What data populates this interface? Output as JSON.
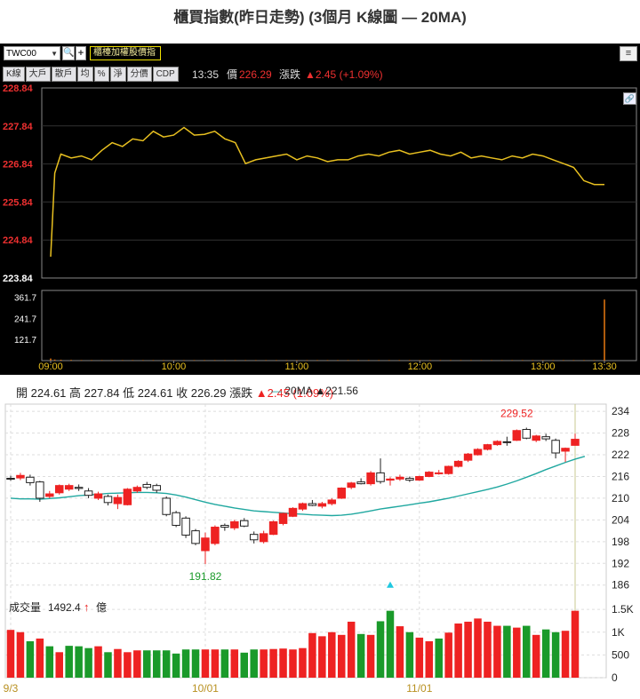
{
  "page_title": "櫃買指數(昨日走勢) (3個月 K線圖  — 20MA)",
  "intraday": {
    "symbol": "TWC00",
    "symbol_dropdown": "▼",
    "search_glyph": "🔍",
    "add_glyph": "+",
    "index_name": "櫃檯加權股價指",
    "menu_glyph": "≡",
    "link_glyph": "🔗",
    "buttons": [
      "K線",
      "大戶",
      "散戶",
      "均",
      "%",
      "淨",
      "分價",
      "CDP"
    ],
    "time": "13:35",
    "price_label": "價",
    "price": "226.29",
    "change_label": "漲跌",
    "change": "▲2.45 (+1.09%)",
    "price_ticks": [
      "228.84",
      "227.84",
      "226.84",
      "225.84",
      "224.84",
      "223.84"
    ],
    "volume_ticks": [
      "361.7",
      "241.7",
      "121.7"
    ],
    "time_ticks": [
      "09:00",
      "10:00",
      "11:00",
      "12:00",
      "13:00",
      "13:30"
    ],
    "colors": {
      "price_line": "#e8c020",
      "volume": "#d87010",
      "up": "#ee2222",
      "down": "#1a9a2a",
      "ma": "#20a8a0"
    }
  },
  "chart_data": [
    {
      "type": "line",
      "name_hint": "intraday",
      "x": [
        "09:00",
        "09:02",
        "09:05",
        "09:10",
        "09:15",
        "09:20",
        "09:25",
        "09:30",
        "09:35",
        "09:40",
        "09:45",
        "09:50",
        "09:55",
        "10:00",
        "10:05",
        "10:10",
        "10:15",
        "10:20",
        "10:25",
        "10:30",
        "10:35",
        "10:40",
        "10:45",
        "10:50",
        "10:55",
        "11:00",
        "11:05",
        "11:10",
        "11:15",
        "11:20",
        "11:25",
        "11:30",
        "11:35",
        "11:40",
        "11:45",
        "11:50",
        "11:55",
        "12:00",
        "12:05",
        "12:10",
        "12:15",
        "12:20",
        "12:25",
        "12:30",
        "12:35",
        "12:40",
        "12:45",
        "12:50",
        "12:55",
        "13:00",
        "13:05",
        "13:10",
        "13:15",
        "13:20",
        "13:25",
        "13:30"
      ],
      "values": [
        224.4,
        226.6,
        227.1,
        227.0,
        227.05,
        226.95,
        227.2,
        227.4,
        227.3,
        227.5,
        227.45,
        227.7,
        227.55,
        227.6,
        227.8,
        227.6,
        227.62,
        227.7,
        227.5,
        227.4,
        226.85,
        226.95,
        227.0,
        227.05,
        227.1,
        226.95,
        227.05,
        227.0,
        226.9,
        226.95,
        226.95,
        227.05,
        227.1,
        227.05,
        227.15,
        227.2,
        227.1,
        227.15,
        227.2,
        227.1,
        227.05,
        227.15,
        227.0,
        227.05,
        227.0,
        226.95,
        227.05,
        227.0,
        227.1,
        227.05,
        226.95,
        226.85,
        226.75,
        226.4,
        226.3,
        226.3
      ],
      "ylim": [
        223.84,
        228.84
      ],
      "volume": [
        12,
        6,
        5,
        4,
        3,
        3,
        3,
        3,
        3,
        3,
        3,
        3,
        3,
        3,
        3,
        3,
        3,
        3,
        3,
        3,
        3,
        3,
        3,
        3,
        3,
        3,
        3,
        3,
        3,
        3,
        3,
        3,
        3,
        3,
        3,
        3,
        3,
        3,
        3,
        3,
        3,
        3,
        3,
        3,
        3,
        3,
        3,
        3,
        3,
        3,
        3,
        3,
        3,
        3,
        3,
        348
      ],
      "volume_ylim": [
        0,
        400
      ]
    },
    {
      "type": "candlestick",
      "name_hint": "daily 3 months",
      "ohlc_header": {
        "open_label": "開",
        "open": "224.61",
        "high_label": "高",
        "high": "227.84",
        "low_label": "低",
        "low": "224.61",
        "close_label": "收",
        "close": "226.29",
        "change_label": "漲跌",
        "change": "▲2.45 (1.09%)"
      },
      "ma": {
        "label": "20MA",
        "value": "▲221.56"
      },
      "price_ticks": [
        "234",
        "228",
        "222",
        "216",
        "210",
        "204",
        "198",
        "192",
        "186"
      ],
      "volume_ticks": [
        "1.5K",
        "1K",
        "500",
        "0"
      ],
      "date_ticks": [
        "9/3",
        "10/01",
        "11/01"
      ],
      "annotations": {
        "high": "229.52",
        "low": "191.82"
      },
      "volume_header": {
        "label": "成交量",
        "value": "1492.4",
        "arrow": "↑",
        "unit": "億"
      },
      "ylim": [
        182,
        236
      ],
      "volume_ylim": [
        0,
        1600
      ],
      "candles": [
        [
          215.5,
          216.2,
          214.8,
          215.4
        ],
        [
          215.6,
          217.0,
          215.0,
          216.3
        ],
        [
          215.8,
          216.5,
          213.5,
          214.3
        ],
        [
          214.5,
          214.8,
          209.0,
          210.0
        ],
        [
          210.5,
          212.0,
          210.0,
          211.2
        ],
        [
          211.5,
          213.8,
          211.0,
          213.5
        ],
        [
          212.5,
          214.0,
          212.0,
          213.5
        ],
        [
          213.0,
          213.8,
          212.0,
          212.7
        ],
        [
          212.0,
          212.8,
          210.0,
          210.8
        ],
        [
          210.0,
          211.8,
          209.5,
          211.2
        ],
        [
          210.5,
          211.0,
          208.0,
          208.8
        ],
        [
          208.5,
          211.0,
          207.0,
          210.2
        ],
        [
          208.2,
          212.8,
          208.0,
          212.5
        ],
        [
          212.0,
          213.5,
          211.5,
          213.0
        ],
        [
          213.8,
          214.5,
          212.5,
          213.0
        ],
        [
          213.5,
          214.0,
          211.5,
          212.2
        ],
        [
          210.0,
          210.5,
          205.0,
          205.5
        ],
        [
          206.0,
          206.5,
          202.0,
          202.5
        ],
        [
          204.5,
          205.0,
          199.0,
          199.8
        ],
        [
          201.0,
          201.5,
          197.0,
          197.5
        ],
        [
          195.5,
          200.5,
          191.8,
          199.0
        ],
        [
          197.5,
          202.5,
          197.0,
          202.0
        ],
        [
          202.5,
          203.0,
          201.0,
          202.0
        ],
        [
          201.8,
          204.0,
          201.2,
          203.5
        ],
        [
          203.8,
          204.5,
          202.0,
          202.3
        ],
        [
          200.0,
          200.8,
          197.5,
          198.5
        ],
        [
          198.0,
          201.0,
          197.5,
          200.2
        ],
        [
          200.0,
          203.8,
          199.8,
          203.5
        ],
        [
          203.0,
          206.0,
          202.5,
          205.8
        ],
        [
          205.0,
          207.5,
          204.8,
          207.2
        ],
        [
          207.0,
          208.8,
          206.5,
          208.5
        ],
        [
          208.5,
          209.5,
          207.8,
          208.0
        ],
        [
          207.8,
          209.0,
          207.2,
          208.5
        ],
        [
          208.5,
          210.0,
          208.0,
          209.5
        ],
        [
          210.0,
          213.0,
          209.8,
          212.8
        ],
        [
          213.0,
          214.5,
          212.5,
          214.2
        ],
        [
          214.5,
          215.5,
          213.8,
          214.0
        ],
        [
          214.0,
          217.5,
          213.5,
          217.0
        ],
        [
          217.0,
          221.0,
          214.0,
          214.6
        ],
        [
          215.0,
          215.8,
          213.5,
          215.3
        ],
        [
          215.3,
          216.5,
          214.8,
          215.8
        ],
        [
          215.5,
          216.0,
          214.5,
          215.0
        ],
        [
          215.0,
          216.2,
          214.8,
          216.0
        ],
        [
          216.0,
          217.5,
          215.8,
          217.2
        ],
        [
          217.0,
          217.8,
          216.5,
          217.0
        ],
        [
          216.8,
          219.0,
          216.5,
          218.8
        ],
        [
          218.8,
          220.5,
          218.5,
          220.2
        ],
        [
          220.5,
          222.5,
          220.0,
          222.2
        ],
        [
          222.0,
          223.8,
          221.8,
          223.5
        ],
        [
          223.5,
          225.0,
          223.2,
          224.8
        ],
        [
          224.8,
          226.0,
          224.5,
          225.7
        ],
        [
          225.6,
          227.0,
          224.5,
          225.5
        ],
        [
          226.0,
          229.0,
          225.8,
          228.7
        ],
        [
          229.0,
          229.5,
          226.3,
          226.6
        ],
        [
          226.0,
          227.5,
          225.5,
          227.2
        ],
        [
          227.0,
          227.8,
          225.8,
          226.4
        ],
        [
          226.0,
          226.5,
          221.0,
          222.5
        ],
        [
          223.0,
          224.0,
          220.0,
          223.8
        ],
        [
          224.61,
          227.84,
          224.61,
          226.29
        ]
      ],
      "ma_values": [
        210.0,
        209.8,
        209.8,
        209.7,
        209.9,
        210.1,
        210.4,
        210.7,
        210.9,
        211.1,
        211.3,
        211.4,
        211.5,
        211.6,
        211.6,
        211.5,
        211.3,
        210.9,
        210.3,
        209.6,
        208.9,
        208.3,
        207.8,
        207.3,
        206.9,
        206.5,
        206.3,
        206.1,
        205.9,
        205.7,
        205.6,
        205.4,
        205.3,
        205.2,
        205.3,
        205.6,
        206.0,
        206.5,
        207.0,
        207.4,
        207.8,
        208.2,
        208.6,
        209.0,
        209.5,
        210.0,
        210.6,
        211.2,
        211.8,
        212.4,
        213.1,
        213.9,
        214.8,
        215.8,
        216.8,
        217.9,
        218.9,
        219.9,
        220.8,
        221.56
      ],
      "volumes": [
        1050,
        1000,
        800,
        860,
        690,
        560,
        700,
        690,
        650,
        690,
        560,
        630,
        560,
        600,
        600,
        600,
        600,
        530,
        620,
        620,
        620,
        620,
        620,
        620,
        550,
        620,
        620,
        630,
        640,
        620,
        650,
        980,
        910,
        1000,
        940,
        1230,
        960,
        940,
        1240,
        1470,
        1130,
        1000,
        880,
        800,
        860,
        990,
        1190,
        1230,
        1300,
        1230,
        1140,
        1140,
        1100,
        1140,
        940,
        1060,
        1000,
        1030,
        1470
      ],
      "volume_up": [
        true,
        true,
        false,
        true,
        false,
        true,
        false,
        false,
        false,
        true,
        false,
        true,
        true,
        true,
        false,
        false,
        false,
        false,
        false,
        false,
        true,
        true,
        false,
        true,
        false,
        false,
        true,
        true,
        true,
        true,
        true,
        true,
        true,
        true,
        true,
        true,
        false,
        true,
        false,
        false,
        true,
        false,
        true,
        true,
        false,
        true,
        true,
        true,
        true,
        true,
        true,
        false,
        true,
        false,
        true,
        false,
        false,
        true,
        true
      ]
    }
  ]
}
